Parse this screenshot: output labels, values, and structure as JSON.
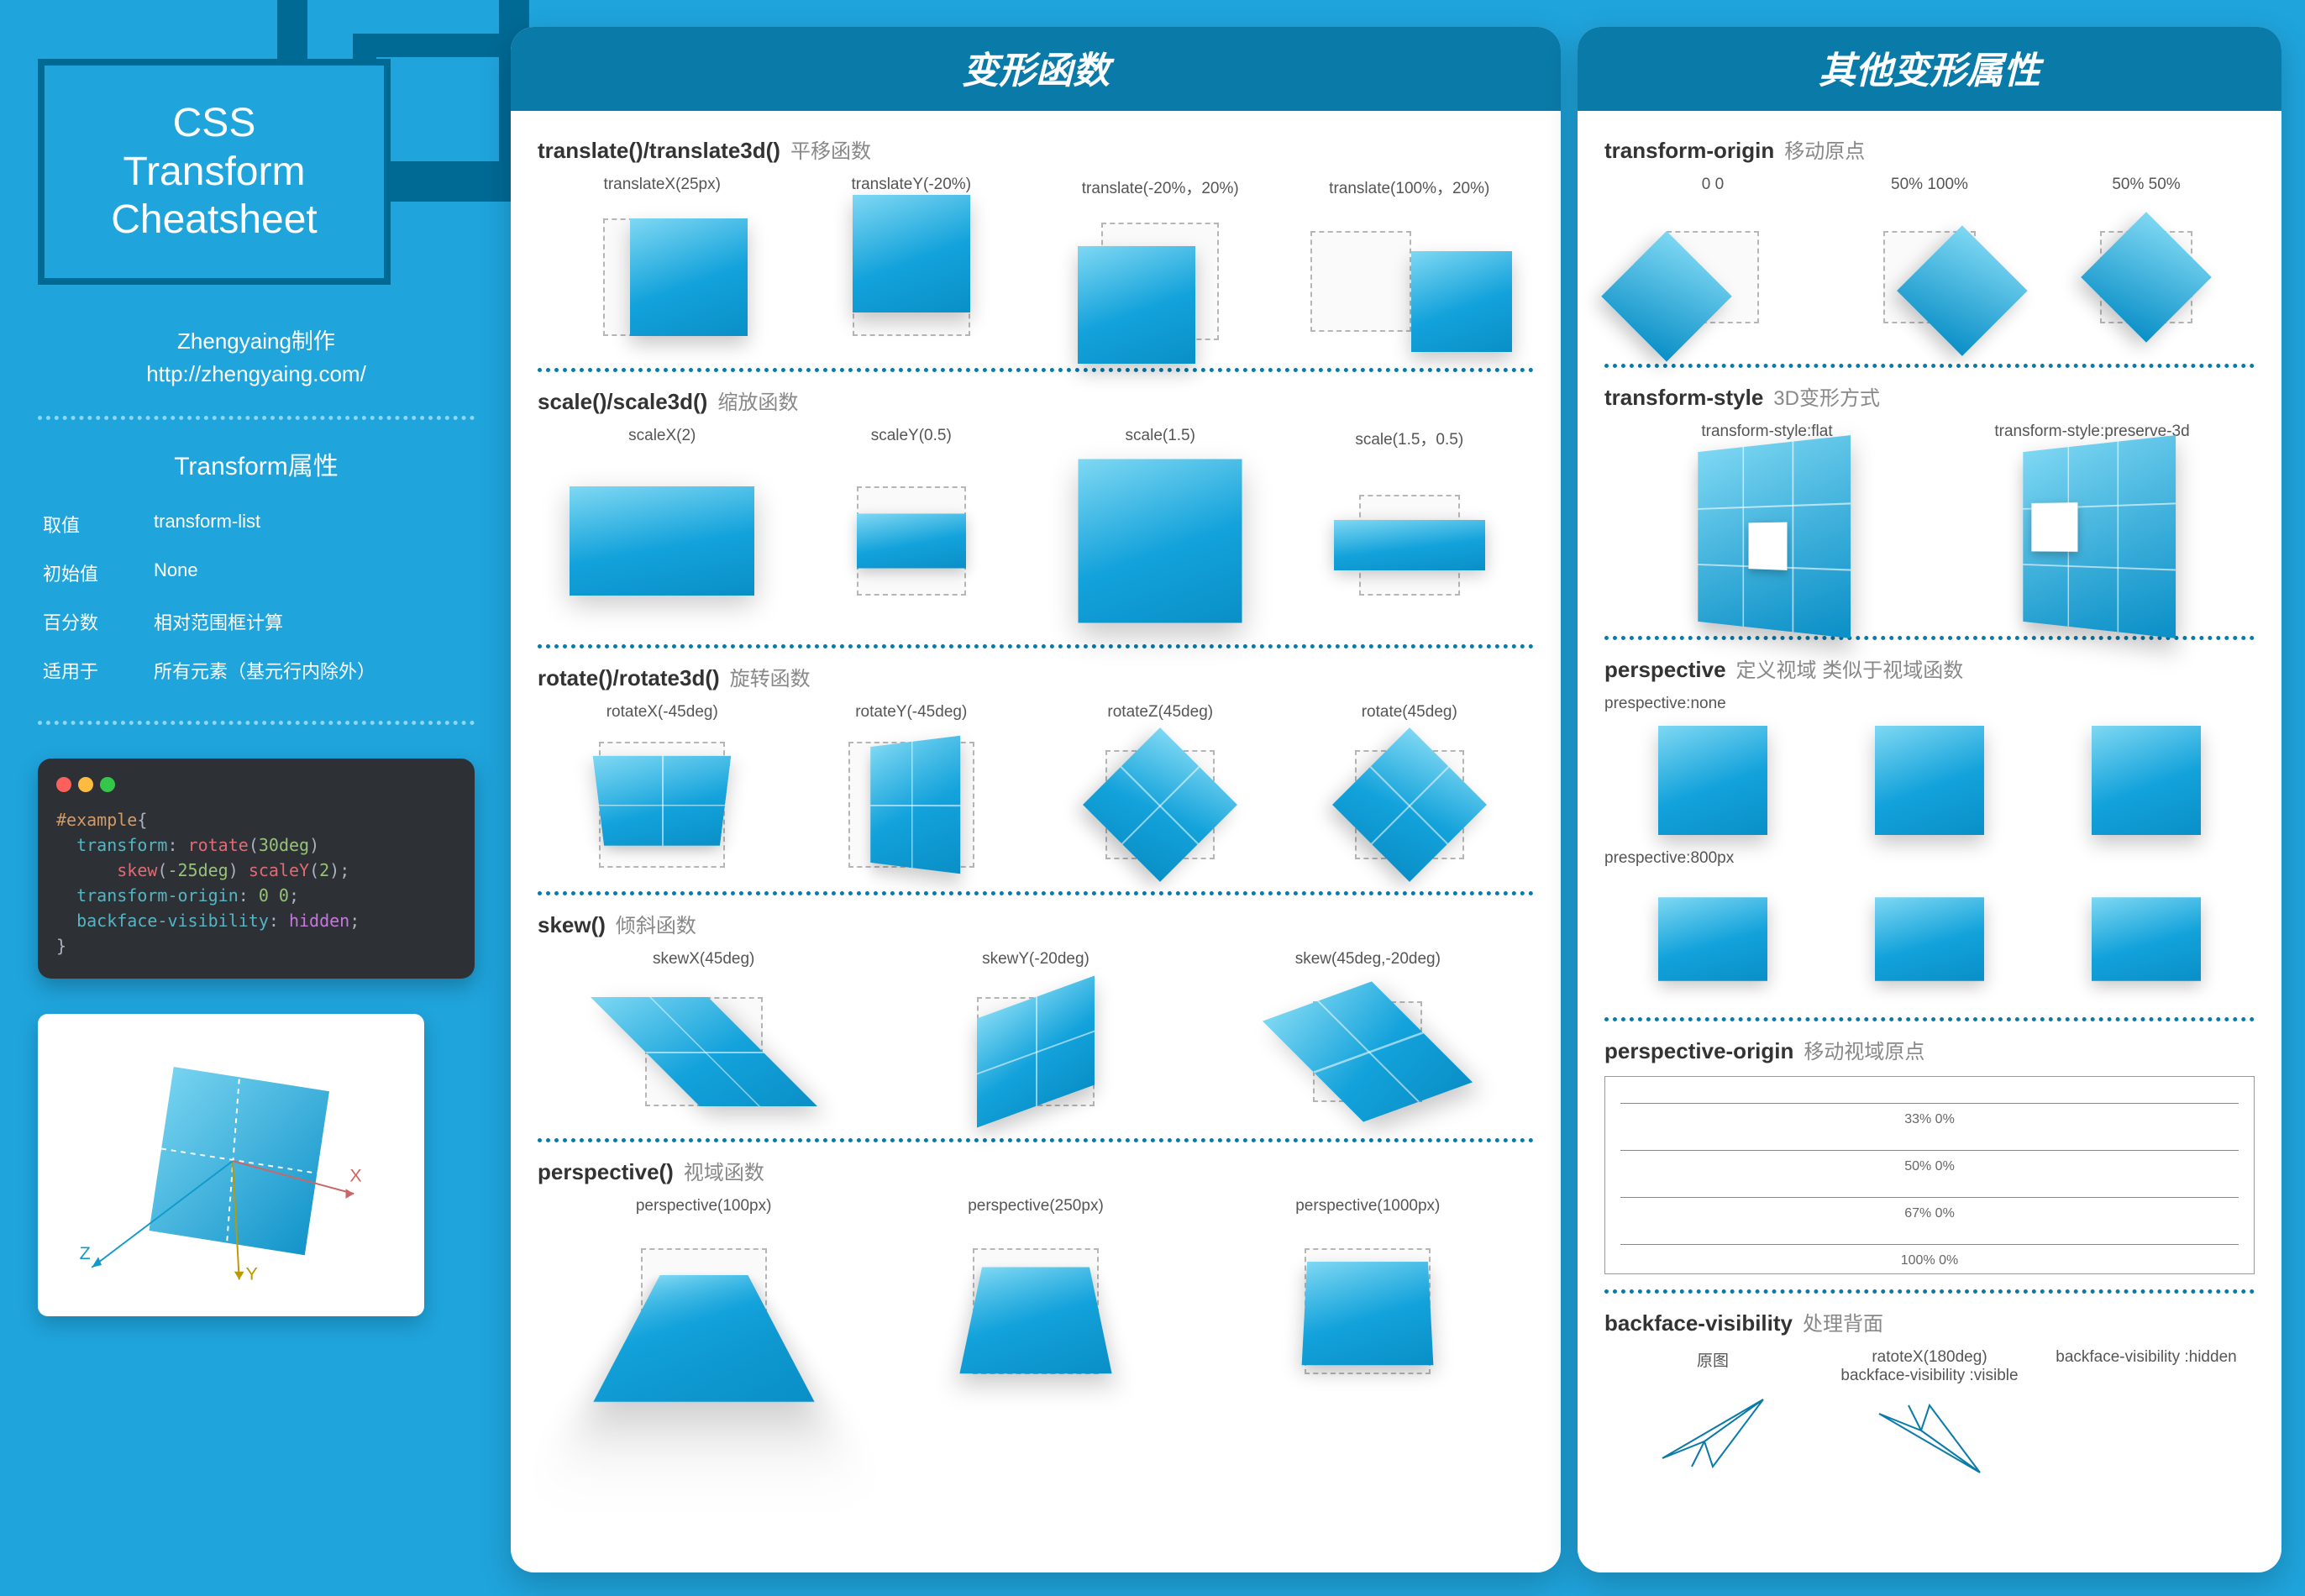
{
  "title": {
    "l1": "CSS",
    "l2": "Transform",
    "l3": "Cheatsheet"
  },
  "credit": {
    "author": "Zhengyaing制作",
    "url": "http://zhengyaing.com/"
  },
  "propSection": {
    "heading": "Transform属性",
    "rows": [
      {
        "k": "取值",
        "v": "transform-list"
      },
      {
        "k": "初始值",
        "v": "None"
      },
      {
        "k": "百分数",
        "v": "相对范围框计算"
      },
      {
        "k": "适用于",
        "v": "所有元素（基元行内除外）"
      }
    ]
  },
  "code": {
    "selector": "#example",
    "l1a": "transform",
    "l1b": "rotate",
    "l1c": "30deg",
    "l2a": "skew",
    "l2b": "-25deg",
    "l2c": "scaleY",
    "l2d": "2",
    "l3a": "transform-origin",
    "l3b": "0 0",
    "l4a": "backface-visibility",
    "l4b": "hidden"
  },
  "illu": {
    "xLabel": "X",
    "yLabel": "Y",
    "zLabel": "Z"
  },
  "mainPanel": {
    "heading": "变形函数",
    "sections": [
      {
        "name": "translate()/translate3d()",
        "sub": "平移函数",
        "items": [
          "translateX(25px)",
          "translateY(-20%)",
          "translate(-20%，20%)",
          "translate(100%，20%)"
        ]
      },
      {
        "name": "scale()/scale3d()",
        "sub": "缩放函数",
        "items": [
          "scaleX(2)",
          "scaleY(0.5)",
          "scale(1.5)",
          "scale(1.5，0.5)"
        ]
      },
      {
        "name": "rotate()/rotate3d()",
        "sub": "旋转函数",
        "items": [
          "rotateX(-45deg)",
          "rotateY(-45deg)",
          "rotateZ(45deg)",
          "rotate(45deg)"
        ]
      },
      {
        "name": "skew()",
        "sub": "倾斜函数",
        "items": [
          "skewX(45deg)",
          "skewY(-20deg)",
          "skew(45deg,-20deg)"
        ]
      },
      {
        "name": "perspective()",
        "sub": "视域函数",
        "items": [
          "perspective(100px)",
          "perspective(250px)",
          "perspective(1000px)"
        ]
      }
    ]
  },
  "rightPanel": {
    "heading": "其他变形属性",
    "origin": {
      "name": "transform-origin",
      "sub": "移动原点",
      "items": [
        "0 0",
        "50% 100%",
        "50% 50%"
      ]
    },
    "style3d": {
      "name": "transform-style",
      "sub": "3D变形方式",
      "items": [
        "transform-style:flat",
        "transform-style:preserve-3d"
      ]
    },
    "perspective": {
      "name": "perspective",
      "sub": "定义视域 类似于视域函数",
      "labels": [
        "prespective:none",
        "prespective:800px"
      ]
    },
    "perspOrigin": {
      "name": "perspective-origin",
      "sub": "移动视域原点",
      "rulers": [
        "33% 0%",
        "50% 0%",
        "67% 0%",
        "100% 0%"
      ]
    },
    "backface": {
      "name": "backface-visibility",
      "sub": "处理背面",
      "items": [
        "原图",
        "ratoteX(180deg)\nbackface-visibility :visible",
        "backface-visibility :hidden"
      ]
    }
  }
}
